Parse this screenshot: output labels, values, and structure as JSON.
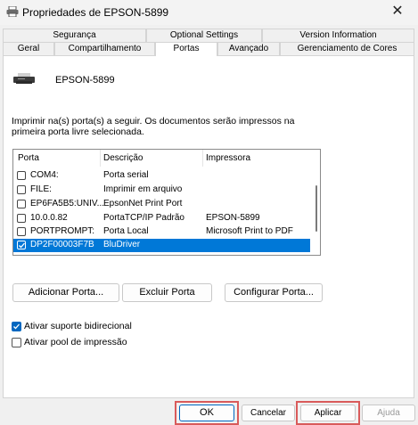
{
  "window": {
    "title": "Propriedades de EPSON-5899"
  },
  "tabs_row1": [
    {
      "label": "Segurança"
    },
    {
      "label": "Optional Settings"
    },
    {
      "label": "Version Information"
    }
  ],
  "tabs_row2": [
    {
      "label": "Geral"
    },
    {
      "label": "Compartilhamento"
    },
    {
      "label": "Portas"
    },
    {
      "label": "Avançado"
    },
    {
      "label": "Gerenciamento de Cores"
    }
  ],
  "printer": {
    "name": "EPSON-5899"
  },
  "description": "Imprimir na(s) porta(s) a seguir. Os documentos serão impressos na primeira porta livre selecionada.",
  "ports": {
    "headers": [
      "Porta",
      "Descrição",
      "Impressora"
    ],
    "rows": [
      {
        "port": "COM4:",
        "description": "Porta serial",
        "printer": "",
        "checked": false
      },
      {
        "port": "FILE:",
        "description": "Imprimir em arquivo",
        "printer": "",
        "checked": false
      },
      {
        "port": "EP6FA5B5:UNIV...",
        "description": "EpsonNet Print Port",
        "printer": "",
        "checked": false
      },
      {
        "port": "10.0.0.82",
        "description": "PortaTCP/IP Padrão",
        "printer": "EPSON-5899",
        "checked": false
      },
      {
        "port": "PORTPROMPT:",
        "description": "Porta Local",
        "printer": "Microsoft Print to PDF",
        "checked": false
      },
      {
        "port": "DP2F00003F7B",
        "description": "BluDriver",
        "printer": "",
        "checked": true
      }
    ]
  },
  "buttons": {
    "add_port": "Adicionar Porta...",
    "delete_port": "Excluir Porta",
    "configure_port": "Configurar Porta...",
    "ok": "OK",
    "cancel": "Cancelar",
    "apply": "Aplicar",
    "help": "Ajuda"
  },
  "options": {
    "bidirectional": {
      "label": "Ativar suporte bidirecional",
      "checked": true
    },
    "pooling": {
      "label": "Ativar pool de impressão",
      "checked": false
    }
  },
  "colors": {
    "selection": "#0078d7",
    "highlight": "#d95b5b",
    "check": "#0067c0"
  }
}
